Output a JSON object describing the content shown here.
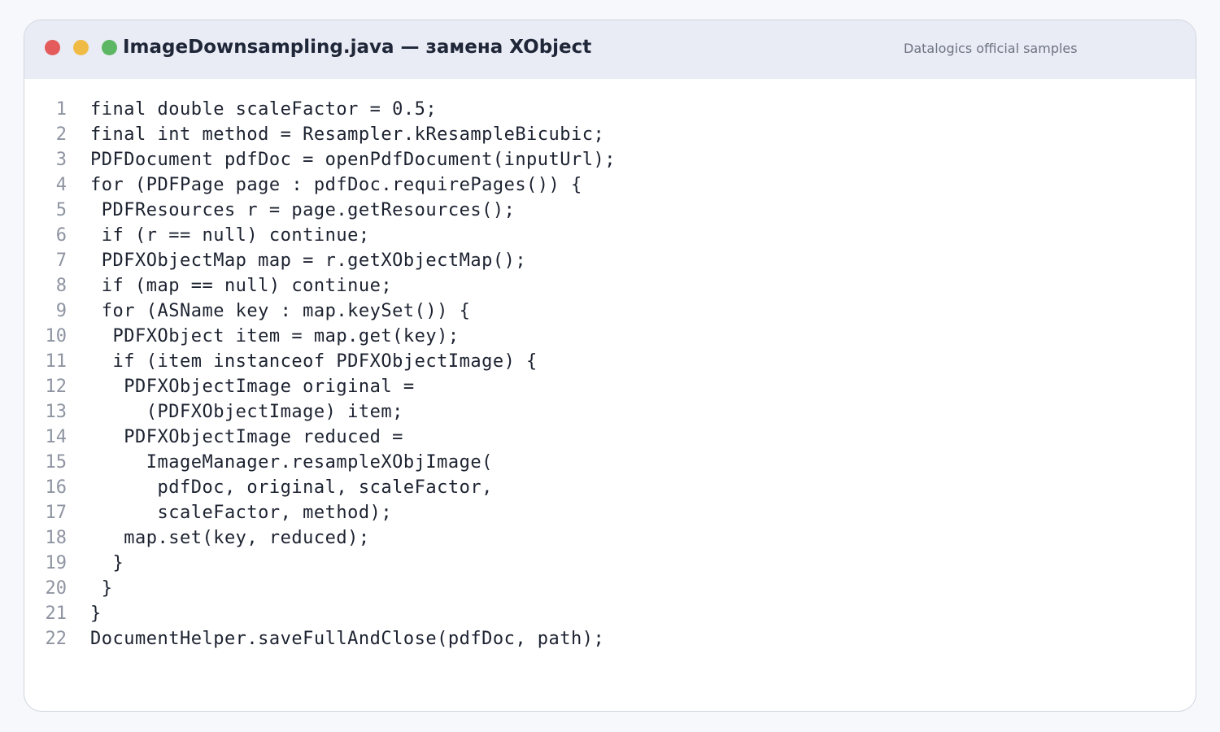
{
  "window": {
    "title": "ImageDownsampling.java — замена XObject",
    "subtitle": "Datalogics official samples",
    "traffic_lights": [
      "#e45b5b",
      "#f0bb45",
      "#5cb663"
    ]
  },
  "code": {
    "lines": [
      {
        "n": "1",
        "text": "final double scaleFactor = 0.5;"
      },
      {
        "n": "2",
        "text": "final int method = Resampler.kResampleBicubic;"
      },
      {
        "n": "3",
        "text": "PDFDocument pdfDoc = openPdfDocument(inputUrl);"
      },
      {
        "n": "4",
        "text": "for (PDFPage page : pdfDoc.requirePages()) {"
      },
      {
        "n": "5",
        "text": " PDFResources r = page.getResources();"
      },
      {
        "n": "6",
        "text": " if (r == null) continue;"
      },
      {
        "n": "7",
        "text": " PDFXObjectMap map = r.getXObjectMap();"
      },
      {
        "n": "8",
        "text": " if (map == null) continue;"
      },
      {
        "n": "9",
        "text": " for (ASName key : map.keySet()) {"
      },
      {
        "n": "10",
        "text": "  PDFXObject item = map.get(key);"
      },
      {
        "n": "11",
        "text": "  if (item instanceof PDFXObjectImage) {"
      },
      {
        "n": "12",
        "text": "   PDFXObjectImage original ="
      },
      {
        "n": "13",
        "text": "     (PDFXObjectImage) item;"
      },
      {
        "n": "14",
        "text": "   PDFXObjectImage reduced ="
      },
      {
        "n": "15",
        "text": "     ImageManager.resampleXObjImage("
      },
      {
        "n": "16",
        "text": "      pdfDoc, original, scaleFactor,"
      },
      {
        "n": "17",
        "text": "      scaleFactor, method);"
      },
      {
        "n": "18",
        "text": "   map.set(key, reduced);"
      },
      {
        "n": "19",
        "text": "  }"
      },
      {
        "n": "20",
        "text": " }"
      },
      {
        "n": "21",
        "text": "}"
      },
      {
        "n": "22",
        "text": "DocumentHelper.saveFullAndClose(pdfDoc, path);"
      }
    ]
  }
}
